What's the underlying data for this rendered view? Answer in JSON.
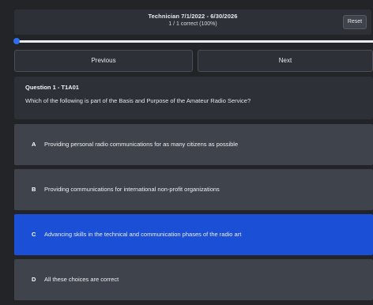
{
  "header": {
    "title": "Technician 7/1/2022 - 6/30/2026",
    "score": "1 / 1 correct (100%)",
    "reset_label": "Reset"
  },
  "progress": {
    "fraction": 1.0
  },
  "nav": {
    "previous_label": "Previous",
    "next_label": "Next"
  },
  "question": {
    "id": "Question 1 - T1A01",
    "text": "Which of the following is part of the Basis and Purpose of the Amateur Radio Service?"
  },
  "answers": [
    {
      "letter": "A",
      "text": "Providing personal radio communications for as many citizens as possible",
      "selected": false
    },
    {
      "letter": "B",
      "text": "Providing communications for international non-profit organizations",
      "selected": false
    },
    {
      "letter": "C",
      "text": "Advancing skills in the technical and communication phases of the radio art",
      "selected": true
    },
    {
      "letter": "D",
      "text": "All these choices are correct",
      "selected": false
    }
  ],
  "colors": {
    "background": "#222428",
    "panel": "#2d3137",
    "answer": "#3f434b",
    "selected_answer": "#1a4fd6",
    "progress_knob": "#2f6df3"
  }
}
